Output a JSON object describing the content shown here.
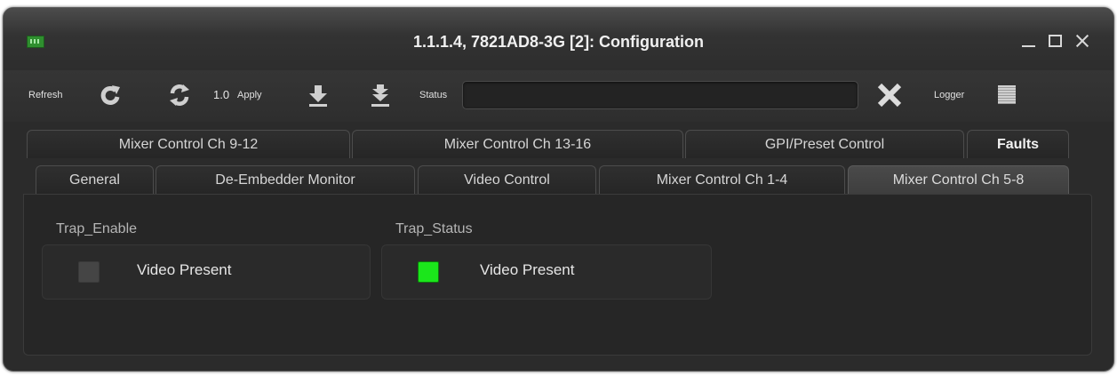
{
  "window": {
    "title": "1.1.1.4, 7821AD8-3G  [2]: Configuration",
    "app_icon": "device-card-icon",
    "controls": [
      "minimize-icon",
      "maximize-icon",
      "close-icon"
    ]
  },
  "toolbar": {
    "refresh_label": "Refresh",
    "refresh_icon": "refresh-icon",
    "update_icon": "sync-icon",
    "version": "1.0",
    "apply_label": "Apply",
    "download_icon": "download-arrow-icon",
    "download_all_icon": "download-all-icon",
    "status_label": "Status",
    "status_value": "",
    "clear_icon": "x-clear-icon",
    "logger_label": "Logger",
    "logger_icon": "logger-icon"
  },
  "tabs": {
    "row1": [
      "Mixer Control Ch 9-12",
      "Mixer Control Ch 13-16",
      "GPI/Preset Control",
      "Faults"
    ],
    "row2": [
      "General",
      "De-Embedder Monitor",
      "Video Control",
      "Mixer Control Ch 1-4",
      "Mixer Control Ch 5-8"
    ],
    "active": "Mixer Control Ch 5-8"
  },
  "faults": {
    "trap_enable": {
      "label": "Trap_Enable",
      "item": "Video Present",
      "checked": false
    },
    "trap_status": {
      "label": "Trap_Status",
      "item": "Video Present",
      "active": true
    }
  },
  "colors": {
    "status_on": "#1be61b",
    "status_off": "#454545",
    "background": "#2b2b2b"
  }
}
